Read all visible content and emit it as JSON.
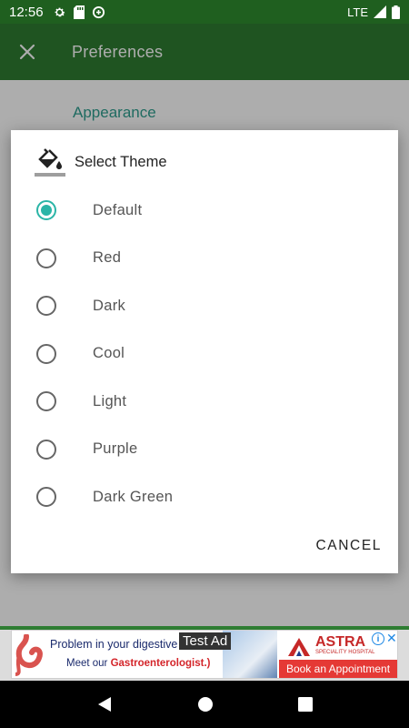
{
  "status_bar": {
    "time": "12:56",
    "network": "LTE",
    "icons": [
      "settings-icon",
      "sd-card-icon",
      "data-saver-icon",
      "signal-icon",
      "battery-icon"
    ]
  },
  "app_bar": {
    "title": "Preferences",
    "close_icon": "close-icon",
    "color": "#2e7d32"
  },
  "content": {
    "section_title": "Appearance",
    "section_color": "#2e9e8f"
  },
  "dialog": {
    "title": "Select Theme",
    "icon": "paint-bucket-icon",
    "options": [
      {
        "label": "Default",
        "selected": true
      },
      {
        "label": "Red",
        "selected": false
      },
      {
        "label": "Dark",
        "selected": false
      },
      {
        "label": "Cool",
        "selected": false
      },
      {
        "label": "Light",
        "selected": false
      },
      {
        "label": "Purple",
        "selected": false
      },
      {
        "label": "Dark Green",
        "selected": false
      }
    ],
    "cancel_label": "CANCEL",
    "accent_color": "#2bb5a7"
  },
  "ad": {
    "line1": "Problem in your digestive s",
    "line2_prefix": "Meet our ",
    "line2_highlight": "Gastroenterologist.)",
    "test_label": "Test Ad",
    "brand": "ASTRA",
    "brand_sub": "SPECIALITY HOSPITAL",
    "cta": "Book an Appointment",
    "info_icon": "info-icon",
    "close_icon": "ad-close-icon"
  },
  "nav_bar": {
    "back_icon": "back-icon",
    "home_icon": "home-icon",
    "recents_icon": "recents-icon"
  }
}
